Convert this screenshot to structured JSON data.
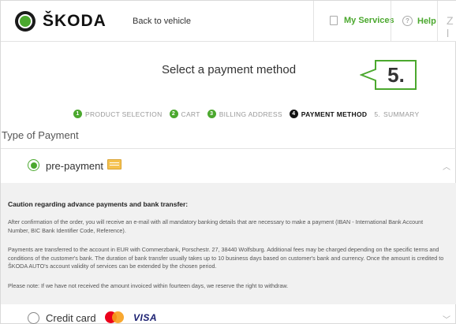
{
  "header": {
    "brand": "ŠKODA",
    "back_link": "Back to vehicle",
    "my_services": "My Services",
    "help": "Help",
    "lang_glyph": "Z l",
    "accent_color": "#4ba82e"
  },
  "page_title": "Select a payment method",
  "step_badge": "5.",
  "steps": [
    {
      "num": "1",
      "label": "PRODUCT SELECTION",
      "state": "done"
    },
    {
      "num": "2",
      "label": "CART",
      "state": "done"
    },
    {
      "num": "3",
      "label": "BILLING ADDRESS",
      "state": "done"
    },
    {
      "num": "4",
      "label": "PAYMENT METHOD",
      "state": "active"
    },
    {
      "num": "5.",
      "label": "SUMMARY",
      "state": "pending"
    }
  ],
  "type_of_payment": "Type of Payment",
  "pre_payment": {
    "label": "pre-payment",
    "selected": true,
    "icon": "bank-card-icon",
    "caution_title": "Caution regarding advance payments and bank transfer:",
    "para1": "After confirmation of the order, you will receive an e-mail with all mandatory banking details that are necessary to make a payment (IBAN - International Bank Account Number, BIC   Bank Identifier Code, Reference).",
    "para2": "Payments are transferred to the account in EUR with Commerzbank, Porschestr. 27, 38440 Wolfsburg. Additional fees may be charged depending on the specific terms and conditions of the customer's bank. The duration of bank transfer usually takes up to 10 business days based on customer's bank and currency. Once the amount is credited to ŠKODA AUTO's account validity of services can be extended by the chosen period.",
    "para3": "Please note: If we have not received the amount invoiced within fourteen days, we reserve the right to withdraw."
  },
  "credit_card": {
    "label": "Credit card",
    "selected": false,
    "visa": "VISA"
  }
}
